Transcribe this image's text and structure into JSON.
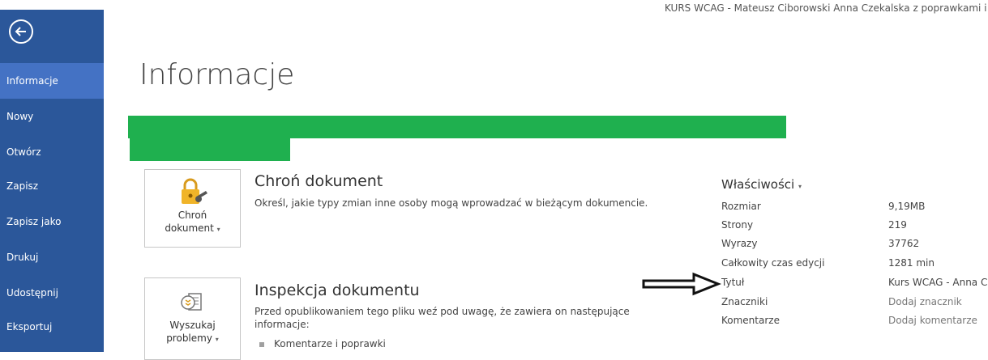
{
  "window": {
    "doc_title": "KURS WCAG - Mateusz Ciborowski Anna Czekalska z poprawkami i"
  },
  "sidebar": {
    "items": [
      {
        "label": "Informacje",
        "active": true
      },
      {
        "label": "Nowy"
      },
      {
        "label": "Otwórz"
      },
      {
        "label": "Zapisz"
      },
      {
        "label": "Zapisz jako"
      },
      {
        "label": "Drukuj"
      },
      {
        "label": "Udostępnij"
      },
      {
        "label": "Eksportuj"
      }
    ]
  },
  "main": {
    "title": "Informacje",
    "protect": {
      "tile_line1": "Chroń",
      "tile_line2": "dokument",
      "title": "Chroń dokument",
      "description": "Określ, jakie typy zmian inne osoby mogą wprowadzać w bieżącym dokumencie."
    },
    "inspect": {
      "tile_line1": "Wyszukaj",
      "tile_line2": "problemy",
      "title": "Inspekcja dokumentu",
      "description": "Przed opublikowaniem tego pliku weź pod uwagę, że zawiera on następujące informacje:",
      "bullets": [
        "Komentarze i poprawki"
      ]
    }
  },
  "properties": {
    "title": "Właściwości",
    "caret": "▾",
    "rows": [
      {
        "label": "Rozmiar",
        "value": "9,19MB"
      },
      {
        "label": "Strony",
        "value": "219"
      },
      {
        "label": "Wyrazy",
        "value": "37762"
      },
      {
        "label": "Całkowity czas edycji",
        "value": "1281 min"
      },
      {
        "label": "Tytuł",
        "value": "Kurs WCAG  - Anna C"
      },
      {
        "label": "Znaczniki",
        "value": "Dodaj znacznik"
      },
      {
        "label": "Komentarze",
        "value": "Dodaj komentarze"
      }
    ]
  },
  "colors": {
    "sidebar": "#2b579a",
    "sidebar_active": "#4472c4",
    "redaction": "#1fb04f"
  }
}
